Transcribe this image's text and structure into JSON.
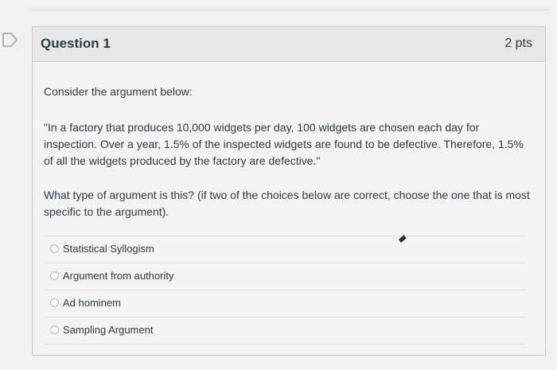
{
  "question": {
    "title": "Question 1",
    "points": "2 pts",
    "intro": "Consider the argument below:",
    "quote": "\"In a factory that produces 10,000 widgets per day, 100 widgets are chosen each day for inspection. Over a year, 1.5% of the inspected widgets are found to be defective. Therefore, 1.5% of all the widgets produced by the factory are defective.\"",
    "prompt": "What type of argument is this? (if two of the choices below are correct, choose the one that is most specific to the argument).",
    "answers": [
      {
        "label": "Statistical Syllogism"
      },
      {
        "label": "Argument from authority"
      },
      {
        "label": "Ad hominem"
      },
      {
        "label": "Sampling Argument"
      }
    ]
  },
  "icons": {
    "flag": "flag-icon",
    "cursor": "mouse-cursor-icon"
  }
}
